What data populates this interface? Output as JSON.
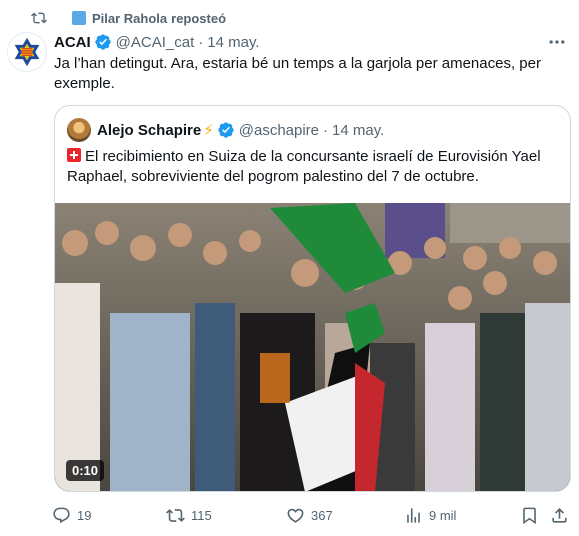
{
  "repost": {
    "user": "Pilar Rahola",
    "label": "reposteó"
  },
  "tweet": {
    "name": "ACAI",
    "handle": "@ACAI_cat",
    "separator": "·",
    "date": "14 may.",
    "text": "Ja l’han detingut. Ara, estaria bé un temps a la garjola per amenaces, per exemple."
  },
  "quote": {
    "name": "Alejo Schapire",
    "handle": "@aschapire",
    "separator": "·",
    "date": "14 may.",
    "text": "El recibimiento en Suiza de la concursante israelí de Eurovisión Yael Raphael, sobreviviente del pogrom palestino del 7 de octubre.",
    "video_time": "0:10"
  },
  "actions": {
    "replies": "19",
    "reposts": "115",
    "likes": "367",
    "views": "9 mil"
  },
  "colors": {
    "verified": "#1d9bf0",
    "muted_text": "#536471",
    "border": "#cfd9de"
  },
  "icons": {
    "repost": "repost-icon",
    "verified": "verified-badge-icon",
    "more": "more-icon",
    "reply": "reply-icon",
    "like": "like-icon",
    "views": "views-icon",
    "bookmark": "bookmark-icon",
    "share": "share-icon"
  }
}
